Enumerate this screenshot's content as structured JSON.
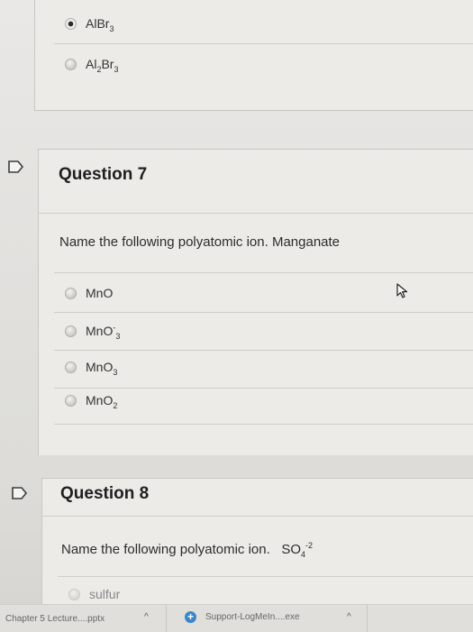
{
  "prev_question": {
    "options": [
      {
        "base": "AlBr",
        "sub": "3",
        "tail": "",
        "selected": true
      },
      {
        "base": "Al",
        "sub": "2",
        "tail": "Br",
        "sub2": "3",
        "selected": false
      }
    ]
  },
  "question7": {
    "title": "Question 7",
    "prompt": "Name the following polyatomic ion.  Manganate",
    "options": [
      {
        "text": "MnO"
      },
      {
        "base": "MnO",
        "sup": "-",
        "sub": "3"
      },
      {
        "base": "MnO",
        "sub": "3"
      },
      {
        "base": "MnO",
        "sub": "2"
      }
    ]
  },
  "question8": {
    "title": "Question 8",
    "prompt": "Name the following polyatomic ion.",
    "formula_base": "SO",
    "formula_sub": "4",
    "formula_sup": "-2",
    "first_option": "sulfur"
  },
  "taskbar": {
    "file1": "Chapter 5 Lecture....pptx",
    "file2": "Support-LogMeIn....exe",
    "caret": "^"
  },
  "icons": {
    "flag": "flag-icon",
    "plus": "plus-circle-icon",
    "cursor": "mouse-cursor-icon"
  },
  "colors": {
    "plus_icon": "#3b86c8"
  }
}
